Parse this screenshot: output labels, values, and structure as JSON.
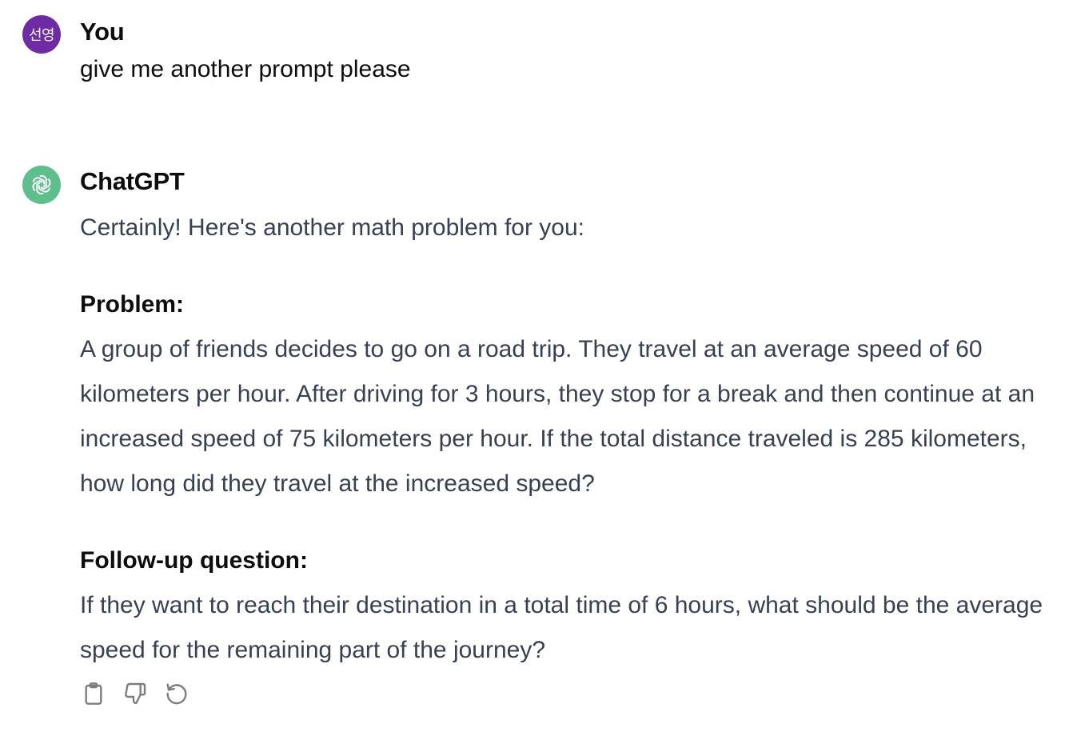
{
  "user_message": {
    "avatar_text": "선영",
    "author": "You",
    "text": "give me another prompt please",
    "avatar_color": "#6e2ba3"
  },
  "assistant_message": {
    "author": "ChatGPT",
    "avatar_icon": "openai-logo-icon",
    "avatar_color": "#5cbf8c",
    "intro": "Certainly! Here's another math problem for you:",
    "problem_heading": "Problem:",
    "problem_text": "A group of friends decides to go on a road trip. They travel at an average speed of 60 kilometers per hour. After driving for 3 hours, they stop for a break and then continue at an increased speed of 75 kilometers per hour. If the total distance traveled is 285 kilometers, how long did they travel at the increased speed?",
    "followup_heading": "Follow-up question:",
    "followup_text": "If they want to reach their destination in a total time of 6 hours, what should be the average speed for the remaining part of the journey?"
  },
  "actions": [
    {
      "icon": "clipboard-icon"
    },
    {
      "icon": "thumbs-down-icon"
    },
    {
      "icon": "regenerate-icon"
    }
  ]
}
